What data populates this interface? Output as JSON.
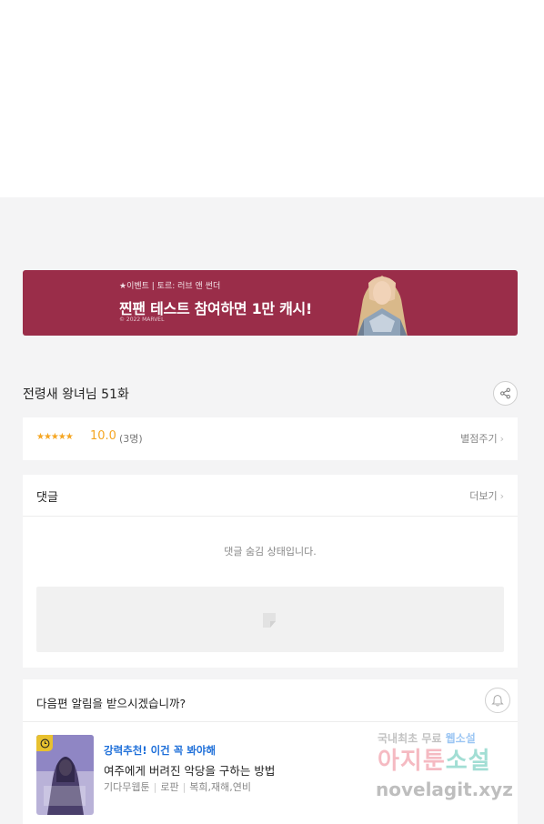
{
  "banner": {
    "small_text": "★이벤트 | 토르: 러브 앤 썬더",
    "title": "찐팬 테스트 참여하면 1만 캐시!",
    "copyright": "© 2022 MARVEL"
  },
  "episode": {
    "title": "전령새 왕녀님 51화",
    "share_icon": "share-icon"
  },
  "rating": {
    "stars": "★★★★★",
    "score": "10.0",
    "count": "(3명)",
    "rate_link": "별점주기",
    "star_color": "#f5a623"
  },
  "comments": {
    "header": "댓글",
    "more_link": "더보기",
    "hidden_message": "댓글 숨김 상태입니다."
  },
  "notify": {
    "question": "다음편 알림을 받으시겠습니까?",
    "bell_icon": "bell-icon"
  },
  "recommendation": {
    "label": "강력추천! 이건 꼭 봐야해",
    "title": "여주에게 버려진 악당을 구하는 방법",
    "publisher": "기다무웹툰",
    "genre": "로판",
    "tags": "복희,재해,연비",
    "clock_icon": "clock-icon"
  },
  "watermark": {
    "line1": "국내최초 무료",
    "line1_accent": "웹소설",
    "line2": "아지툰",
    "line2_accent": "소설",
    "line3": "novelagit.xyz"
  },
  "colors": {
    "banner_bg": "#9a2d49",
    "rec_label": "#1e6fd9",
    "page_bg": "#f4f4f5"
  }
}
